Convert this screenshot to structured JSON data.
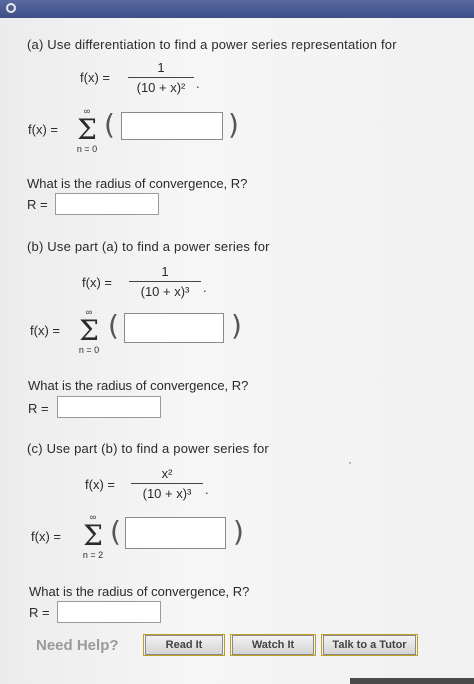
{
  "part_a": {
    "title": "(a) Use differentiation to find a power series representation for",
    "fx_label": "f(x) =",
    "numerator": "1",
    "denominator": "(10 + x)²",
    "trailing": ".",
    "sum_lhs": "f(x) =",
    "sum_top": "∞",
    "sum_bottom": "n = 0",
    "radius_question": "What is the radius of convergence, R?",
    "r_label": "R ="
  },
  "part_b": {
    "title": "(b) Use part (a) to find a power series for",
    "fx_label": "f(x) =",
    "numerator": "1",
    "denominator": "(10 + x)³",
    "trailing": ".",
    "sum_lhs": "f(x) =",
    "sum_top": "∞",
    "sum_bottom": "n = 0",
    "radius_question": "What is the radius of convergence, R?",
    "r_label": "R ="
  },
  "part_c": {
    "title": "(c) Use part (b) to find a power series for",
    "fx_label": "f(x) =",
    "numerator": "x²",
    "denominator": "(10 + x)³",
    "trailing": ".",
    "sum_lhs": "f(x) =",
    "sum_top": "∞",
    "sum_bottom": "n = 2",
    "radius_question": "What is the radius of convergence, R?",
    "r_label": "R ="
  },
  "help": {
    "label": "Need Help?",
    "read_it": "Read It",
    "watch_it": "Watch It",
    "talk_tutor": "Talk to a Tutor"
  }
}
